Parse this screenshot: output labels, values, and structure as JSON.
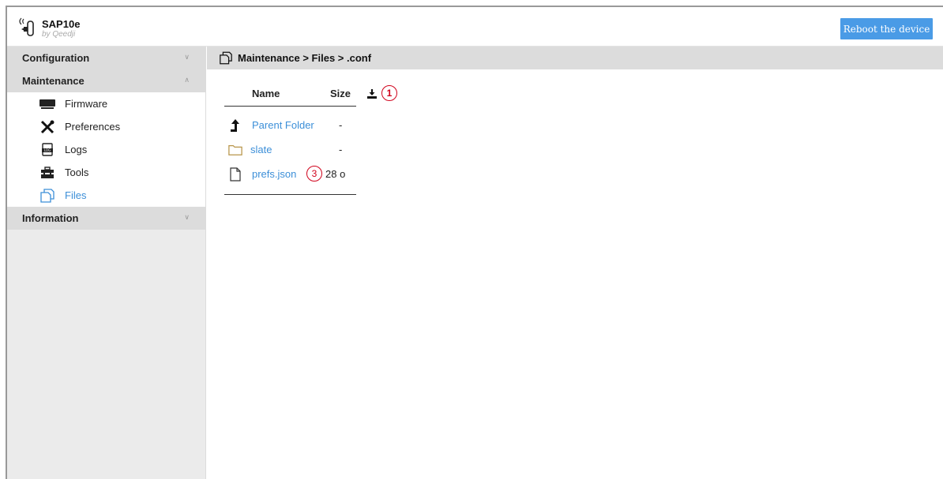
{
  "app": {
    "name": "SAP10e",
    "subtitle": "by Qeedji",
    "reboot_label": "Reboot the device"
  },
  "sidebar": {
    "sections": [
      {
        "label": "Configuration",
        "expanded": false
      },
      {
        "label": "Maintenance",
        "expanded": true
      },
      {
        "label": "Information",
        "expanded": false
      }
    ],
    "maintenance_items": [
      {
        "label": "Firmware",
        "icon": "firmware-icon",
        "active": false
      },
      {
        "label": "Preferences",
        "icon": "tools-cross-icon",
        "active": false
      },
      {
        "label": "Logs",
        "icon": "log-file-icon",
        "active": false
      },
      {
        "label": "Tools",
        "icon": "toolbox-icon",
        "active": false
      },
      {
        "label": "Files",
        "icon": "files-icon",
        "active": true
      }
    ]
  },
  "breadcrumb": {
    "text": "Maintenance > Files > .conf",
    "icon": "files-icon"
  },
  "files": {
    "headers": {
      "name": "Name",
      "size": "Size"
    },
    "download_icon": "download-icon",
    "rows": [
      {
        "name": "Parent Folder",
        "size": "-",
        "icon": "arrow-up-icon"
      },
      {
        "name": "slate",
        "size": "-",
        "icon": "folder-icon"
      },
      {
        "name": "prefs.json",
        "size": "28 o",
        "icon": "file-icon"
      }
    ]
  },
  "annotations": {
    "marker_1": "1",
    "marker_3": "3",
    "color": "#d0021b"
  },
  "colors": {
    "accent": "#4a9be6",
    "link": "#3c8fd8"
  }
}
